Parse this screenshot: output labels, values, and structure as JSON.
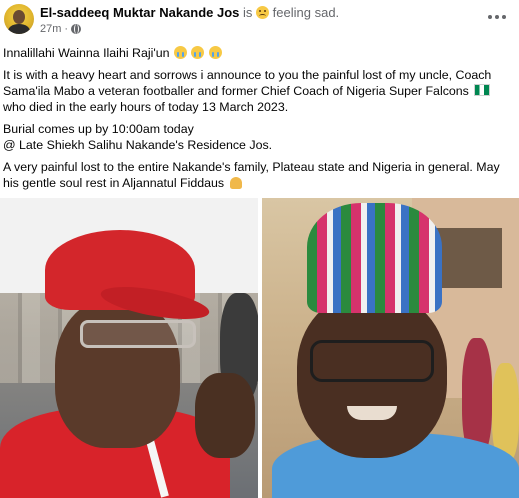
{
  "post": {
    "author": "El-saddeeq Muktar Nakande Jos",
    "feeling_prefix": "is",
    "feeling": "feeling sad.",
    "time": "27m",
    "dot": "·",
    "paragraphs": {
      "p1": "Innalillahi Wainna Ilaihi Raji'un",
      "p2_a": "It is with a heavy heart and sorrows i announce to you the painful lost of my uncle, Coach Sama'ila Mabo a veteran footballer and former Chief Coach of Nigeria Super Falcons",
      "p2_b": "who died in the early hours of today 13 March 2023.",
      "p3_line1": "Burial comes up by 10:00am today",
      "p3_line2": "@ Late Shiekh Salihu Nakande's Residence Jos.",
      "p4": "A very painful lost to the entire Nakande's family, Plateau state and Nigeria in general. May his gentle soul rest in Aljannatul Fiddaus"
    }
  },
  "icons": {
    "feeling": "sad-face-emoji",
    "privacy": "globe-icon",
    "more": "more-options-icon",
    "crying": "loudly-crying-face-emoji",
    "flag": "nigeria-flag-emoji",
    "pray": "folded-hands-emoji"
  },
  "colors": {
    "text": "#050505",
    "secondary_text": "#65676b",
    "background": "#ffffff"
  }
}
